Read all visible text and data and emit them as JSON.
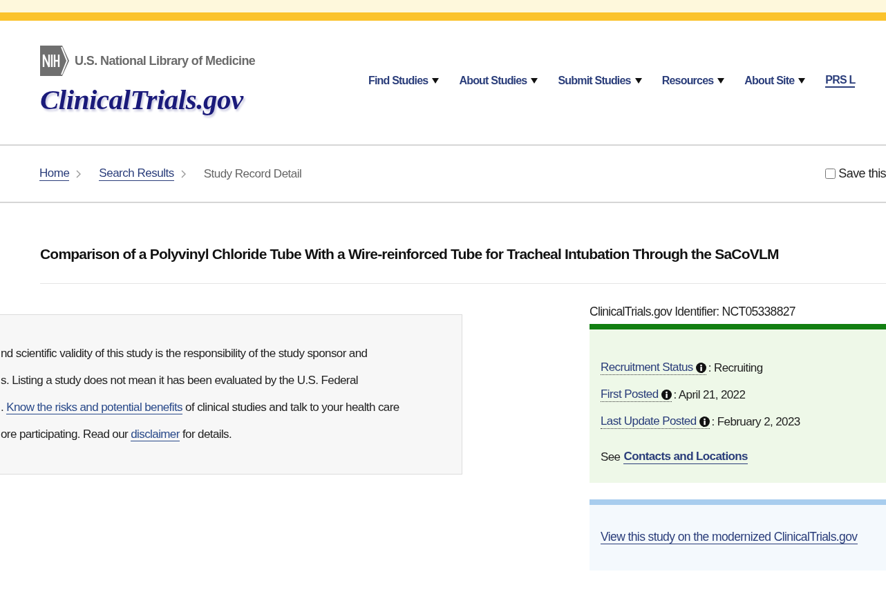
{
  "header": {
    "agency": "U.S. National Library of Medicine",
    "site_name": "ClinicalTrials.gov"
  },
  "nav": [
    {
      "label": "Find Studies",
      "dropdown": true
    },
    {
      "label": "About Studies",
      "dropdown": true
    },
    {
      "label": "Submit Studies",
      "dropdown": true
    },
    {
      "label": "Resources",
      "dropdown": true
    },
    {
      "label": "About Site",
      "dropdown": true
    },
    {
      "label": "PRS L",
      "dropdown": false
    }
  ],
  "breadcrumb": [
    {
      "label": "Home",
      "link": true
    },
    {
      "label": "Search Results",
      "link": true
    },
    {
      "label": "Study Record Detail",
      "link": false
    }
  ],
  "save_checkbox": {
    "label": "Save this",
    "checked": false
  },
  "study_title": "Comparison of a Polyvinyl Chloride Tube With a Wire-reinforced Tube for Tracheal Intubation Through the SaCoVLM",
  "disclaimer_lines": [
    [
      {
        "kind": "text",
        "text": "nd scientific validity of this study is the responsibility of the study sponsor and"
      }
    ],
    [
      {
        "kind": "text",
        "text": "s. Listing a study does not mean it has been evaluated by the U.S. Federal"
      }
    ],
    [
      {
        "kind": "text",
        "text": ". "
      },
      {
        "kind": "link",
        "text": "Know the risks and potential benefits"
      },
      {
        "kind": "text",
        "text": " of clinical studies and talk to your health care"
      }
    ],
    [
      {
        "kind": "text",
        "text": "ore participating. Read our "
      },
      {
        "kind": "link",
        "text": "disclaimer"
      },
      {
        "kind": "text",
        "text": " for details."
      }
    ]
  ],
  "identifier": "ClinicalTrials.gov Identifier: NCT05338827",
  "status_facts": [
    {
      "label": "Recruitment Status",
      "value": ": Recruiting"
    },
    {
      "label": "First Posted",
      "value": ": April 21, 2022"
    },
    {
      "label": "Last Update Posted",
      "value": ": February 2, 2023"
    }
  ],
  "contacts": {
    "prefix": "See",
    "link": "Contacts and Locations"
  },
  "modern_link": "View this study on the modernized ClinicalTrials.gov"
}
